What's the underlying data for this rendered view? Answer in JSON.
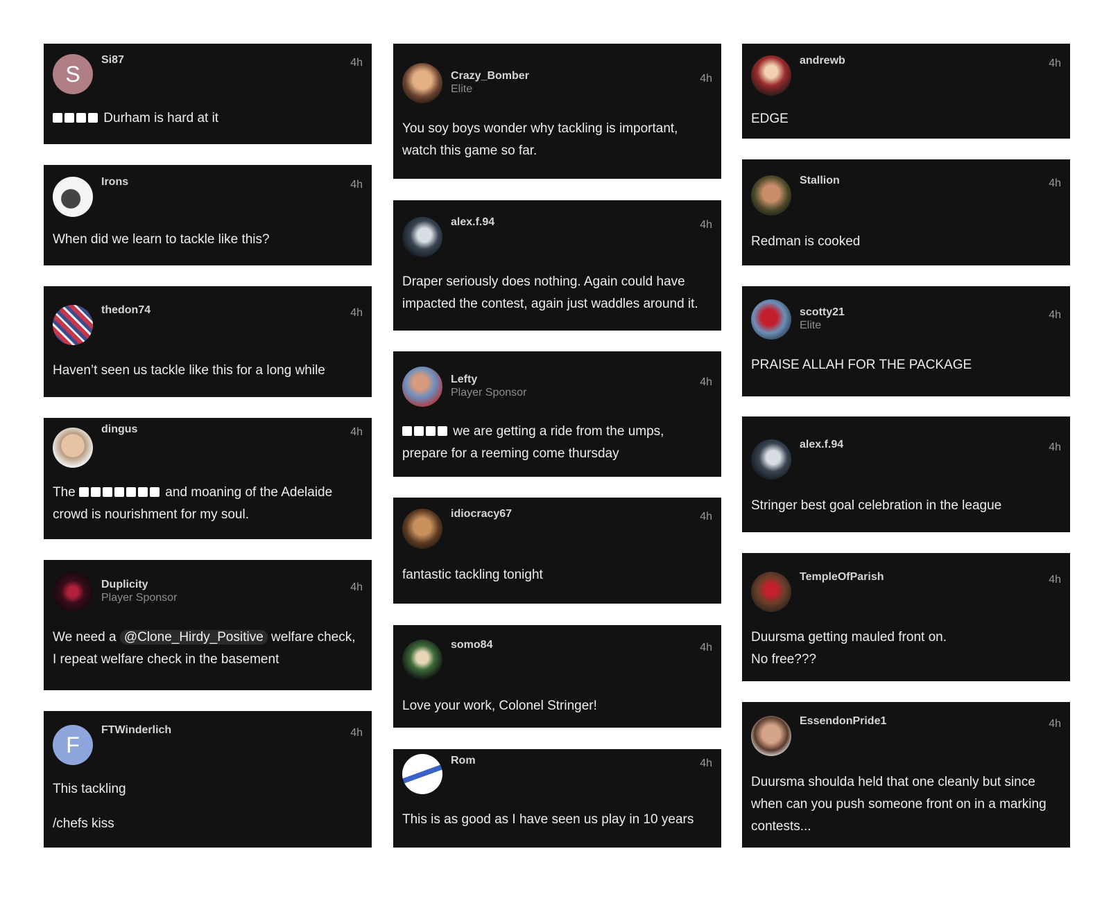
{
  "cards": [
    {
      "user": "Si87",
      "role": "",
      "time": "4h",
      "initial": "S",
      "avatar_color": "#b07e85",
      "body": [
        {
          "censor": 4,
          "text": " Durham is hard at it"
        }
      ]
    },
    {
      "user": "Irons",
      "role": "",
      "time": "4h",
      "body": [
        {
          "text": "When did we learn to tackle like this?"
        }
      ]
    },
    {
      "user": "thedon74",
      "role": "",
      "time": "4h",
      "body": [
        {
          "text": "Haven’t seen us tackle like this for a long while"
        }
      ]
    },
    {
      "user": "dingus",
      "role": "",
      "time": "4h",
      "body": [
        {
          "text": "The "
        },
        {
          "censor": 7,
          "text": " and moaning of the Adelaide crowd is nourishment for my soul."
        }
      ]
    },
    {
      "user": "Duplicity",
      "role": "Player Sponsor",
      "time": "4h",
      "body": [
        {
          "text": "We need a "
        },
        {
          "mention": "@Clone_Hirdy_Positive"
        },
        {
          "text": " welfare check, I repeat welfare check in the basement"
        }
      ]
    },
    {
      "user": "FTWinderlich",
      "role": "",
      "time": "4h",
      "initial": "F",
      "avatar_color": "#8fa6dc",
      "paragraphs": [
        "This tackling",
        "/chefs kiss"
      ]
    },
    {
      "user": "Crazy_Bomber",
      "role": "Elite",
      "time": "4h",
      "body": [
        {
          "text": "You soy boys wonder why tackling is important, watch this game so far."
        }
      ]
    },
    {
      "user": "alex.f.94",
      "role": "",
      "time": "4h",
      "body": [
        {
          "text": "Draper seriously does nothing. Again could have impacted the contest, again just waddles around it."
        }
      ]
    },
    {
      "user": "Lefty",
      "role": "Player Sponsor",
      "time": "4h",
      "body": [
        {
          "censor": 4,
          "text": " we are getting a ride from the umps, prepare for a reeming come thursday"
        }
      ]
    },
    {
      "user": "idiocracy67",
      "role": "",
      "time": "4h",
      "body": [
        {
          "text": "fantastic tackling tonight"
        }
      ]
    },
    {
      "user": "somo84",
      "role": "",
      "time": "4h",
      "body": [
        {
          "text": "Love your work, Colonel Stringer!"
        }
      ]
    },
    {
      "user": "Rom",
      "role": "",
      "time": "4h",
      "body": [
        {
          "text": "This is as good as I have seen us play in 10 years"
        }
      ]
    },
    {
      "user": "andrewb",
      "role": "",
      "time": "4h",
      "body": [
        {
          "text": "EDGE"
        }
      ]
    },
    {
      "user": "Stallion",
      "role": "",
      "time": "4h",
      "body": [
        {
          "text": "Redman is cooked"
        }
      ]
    },
    {
      "user": "scotty21",
      "role": "Elite",
      "time": "4h",
      "body": [
        {
          "text": "PRAISE ALLAH FOR THE PACKAGE"
        }
      ]
    },
    {
      "user": "alex.f.94",
      "role": "",
      "time": "4h",
      "body": [
        {
          "text": "Stringer best goal celebration in the league"
        }
      ]
    },
    {
      "user": "TempleOfParish",
      "role": "",
      "time": "4h",
      "lines": [
        "Duursma getting mauled front on.",
        "No free???"
      ]
    },
    {
      "user": "EssendonPride1",
      "role": "",
      "time": "4h",
      "body": [
        {
          "text": "Duursma shoulda held that one cleanly but since when can you push someone front on in a marking contests..."
        }
      ]
    }
  ]
}
